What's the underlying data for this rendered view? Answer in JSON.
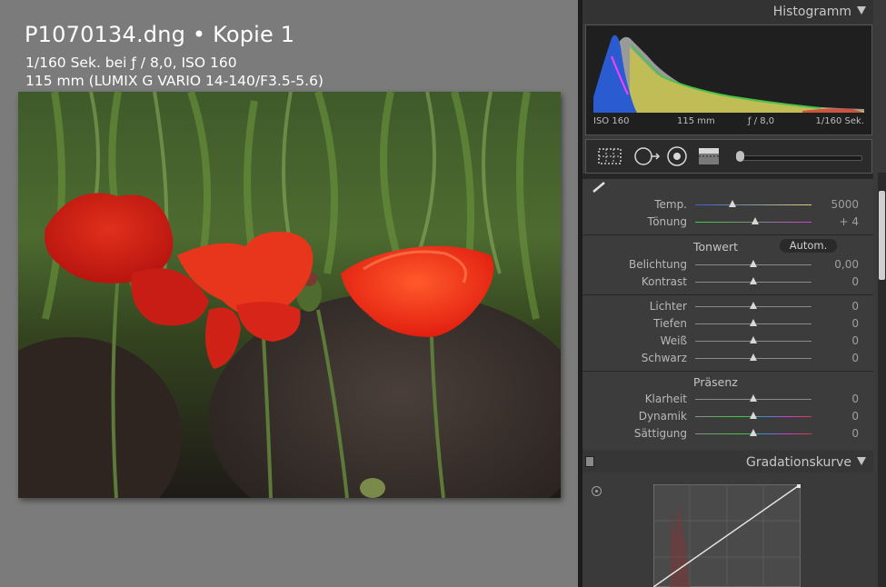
{
  "viewer": {
    "filename": "P1070134.dng • Kopie 1",
    "exif_line1": "1/160 Sek. bei ƒ / 8,0, ISO 160",
    "exif_line2": "115 mm (LUMIX G VARIO 14-140/F3.5-5.6)"
  },
  "histogram": {
    "title": "Histogramm",
    "iso": "ISO 160",
    "focal": "115 mm",
    "aperture": "ƒ / 8,0",
    "shutter": "1/160 Sek."
  },
  "tools": [
    "crop-overlay-icon",
    "spot-removal-icon",
    "red-eye-icon",
    "graduated-filter-icon",
    "brush-slider-icon"
  ],
  "basic": {
    "wb": [
      {
        "label": "Temp.",
        "value": "5000",
        "pos": 0.33,
        "track": "temp"
      },
      {
        "label": "Tönung",
        "value": "+ 4",
        "pos": 0.52,
        "track": "tint"
      }
    ],
    "tone_title": "Tonwert",
    "auto_label": "Autom.",
    "tone": [
      {
        "label": "Belichtung",
        "value": "0,00",
        "pos": 0.5
      },
      {
        "label": "Kontrast",
        "value": "0",
        "pos": 0.5
      }
    ],
    "tone2": [
      {
        "label": "Lichter",
        "value": "0",
        "pos": 0.5
      },
      {
        "label": "Tiefen",
        "value": "0",
        "pos": 0.5
      },
      {
        "label": "Weiß",
        "value": "0",
        "pos": 0.5
      },
      {
        "label": "Schwarz",
        "value": "0",
        "pos": 0.5
      }
    ],
    "presence_title": "Präsenz",
    "presence": [
      {
        "label": "Klarheit",
        "value": "0",
        "pos": 0.5,
        "track": "gray"
      },
      {
        "label": "Dynamik",
        "value": "0",
        "pos": 0.5,
        "track": "color"
      },
      {
        "label": "Sättigung",
        "value": "0",
        "pos": 0.5,
        "track": "color"
      }
    ]
  },
  "curve": {
    "title": "Gradationskurve"
  },
  "colors": {
    "accent_magenta": "#ff3dff",
    "panel_bg": "#3a3a3a",
    "viewer_bg": "#7b7b7b"
  }
}
